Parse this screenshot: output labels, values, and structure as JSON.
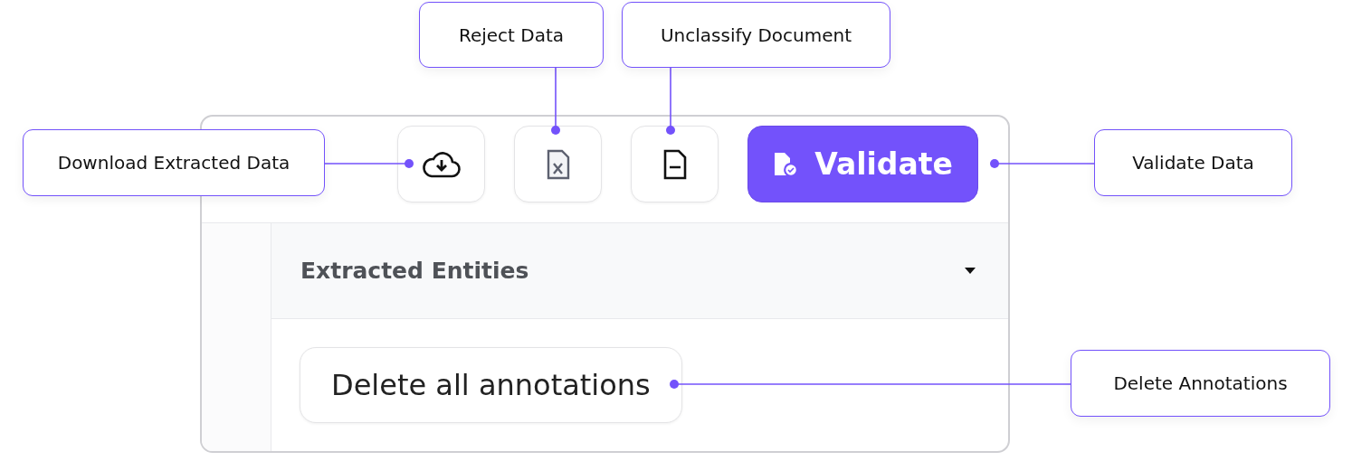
{
  "toolbar": {
    "buttons": [
      {
        "kind": "icon"
      },
      {
        "kind": "icon"
      },
      {
        "kind": "icon"
      },
      {
        "kind": "primary",
        "label": "Validate"
      }
    ]
  },
  "section": {
    "title": "Extracted Entities",
    "expanded": true
  },
  "delete_button": {
    "label": "Delete all annotations"
  },
  "callouts": [
    {
      "text": "Reject Data"
    },
    {
      "text": "Unclassify Document"
    },
    {
      "text": "Download Extracted Data"
    },
    {
      "text": "Validate Data"
    },
    {
      "text": "Delete Annotations"
    }
  ]
}
